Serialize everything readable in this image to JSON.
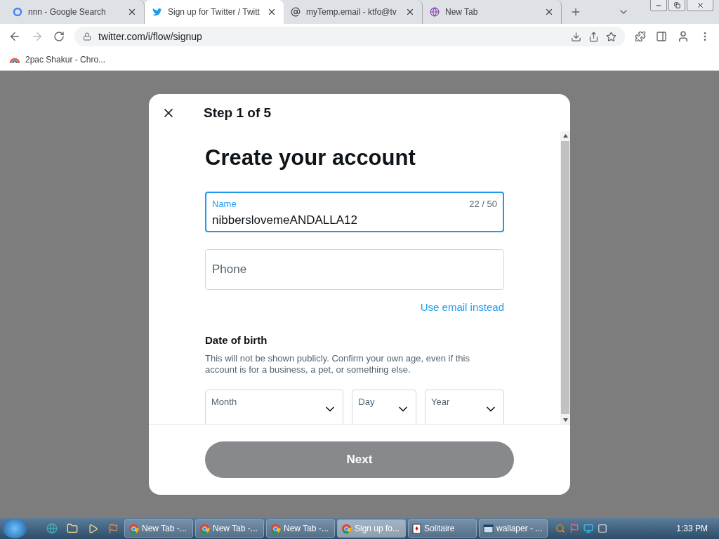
{
  "tabs": [
    {
      "title": "nnn - Google Search",
      "selected": false
    },
    {
      "title": "Sign up for Twitter / Twitt",
      "selected": true
    },
    {
      "title": "myTemp.email - ktfo@tv",
      "selected": false
    },
    {
      "title": "New Tab",
      "selected": false
    }
  ],
  "address": "twitter.com/i/flow/signup",
  "bookmarks": [
    {
      "title": "2pac Shakur - Chro..."
    }
  ],
  "modal": {
    "step": "Step 1 of 5",
    "heading": "Create your account",
    "fields": [
      {
        "label": "Name",
        "value": "nibberslovemeANDALLA12",
        "counter": "22 / 50",
        "focused": true
      },
      {
        "placeholder": "Phone",
        "focused": false
      }
    ],
    "switch_link": "Use email instead",
    "dob_title": "Date of birth",
    "dob_text": "This will not be shown publicly. Confirm your own age, even if this account is for a business, a pet, or something else.",
    "selects": [
      {
        "label": "Month"
      },
      {
        "label": "Day"
      },
      {
        "label": "Year"
      }
    ],
    "next": {
      "label": "Next",
      "disabled": true
    }
  },
  "taskbar": {
    "items": [
      {
        "title": "New Tab -...",
        "selected": false
      },
      {
        "title": "New Tab -...",
        "selected": false
      },
      {
        "title": "New Tab -...",
        "selected": false
      },
      {
        "title": "Sign up fo...",
        "selected": true
      },
      {
        "title": "Solitaire",
        "selected": false
      },
      {
        "title": "wallaper - ...",
        "selected": false
      }
    ],
    "clock": "1:33 PM"
  }
}
